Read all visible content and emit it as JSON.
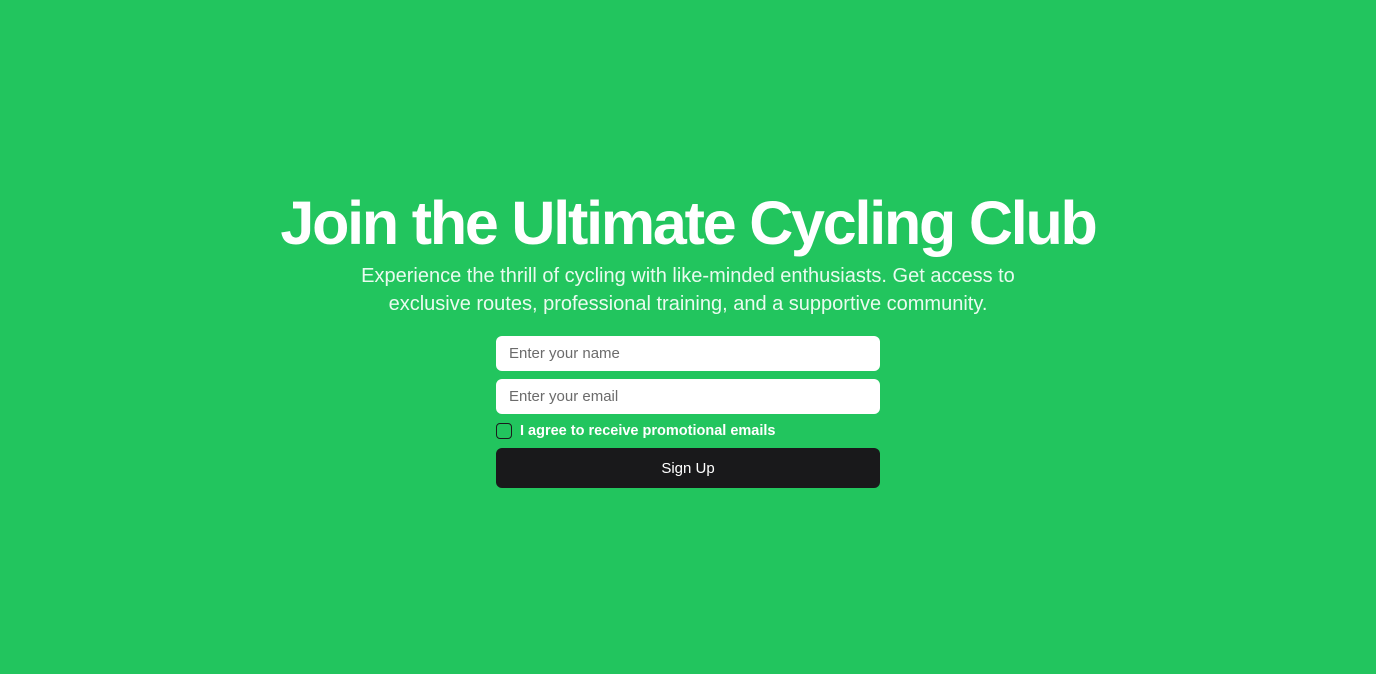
{
  "hero": {
    "title": "Join the Ultimate Cycling Club",
    "subtitle": "Experience the thrill of cycling with like-minded enthusiasts. Get access to exclusive routes, professional training, and a supportive community."
  },
  "form": {
    "name_placeholder": "Enter your name",
    "name_value": "",
    "email_placeholder": "Enter your email",
    "email_value": "",
    "consent_label": "I agree to receive promotional emails",
    "consent_checked": false,
    "submit_label": "Sign Up"
  },
  "colors": {
    "background": "#22c55e",
    "button": "#19191b",
    "text": "#ffffff"
  }
}
